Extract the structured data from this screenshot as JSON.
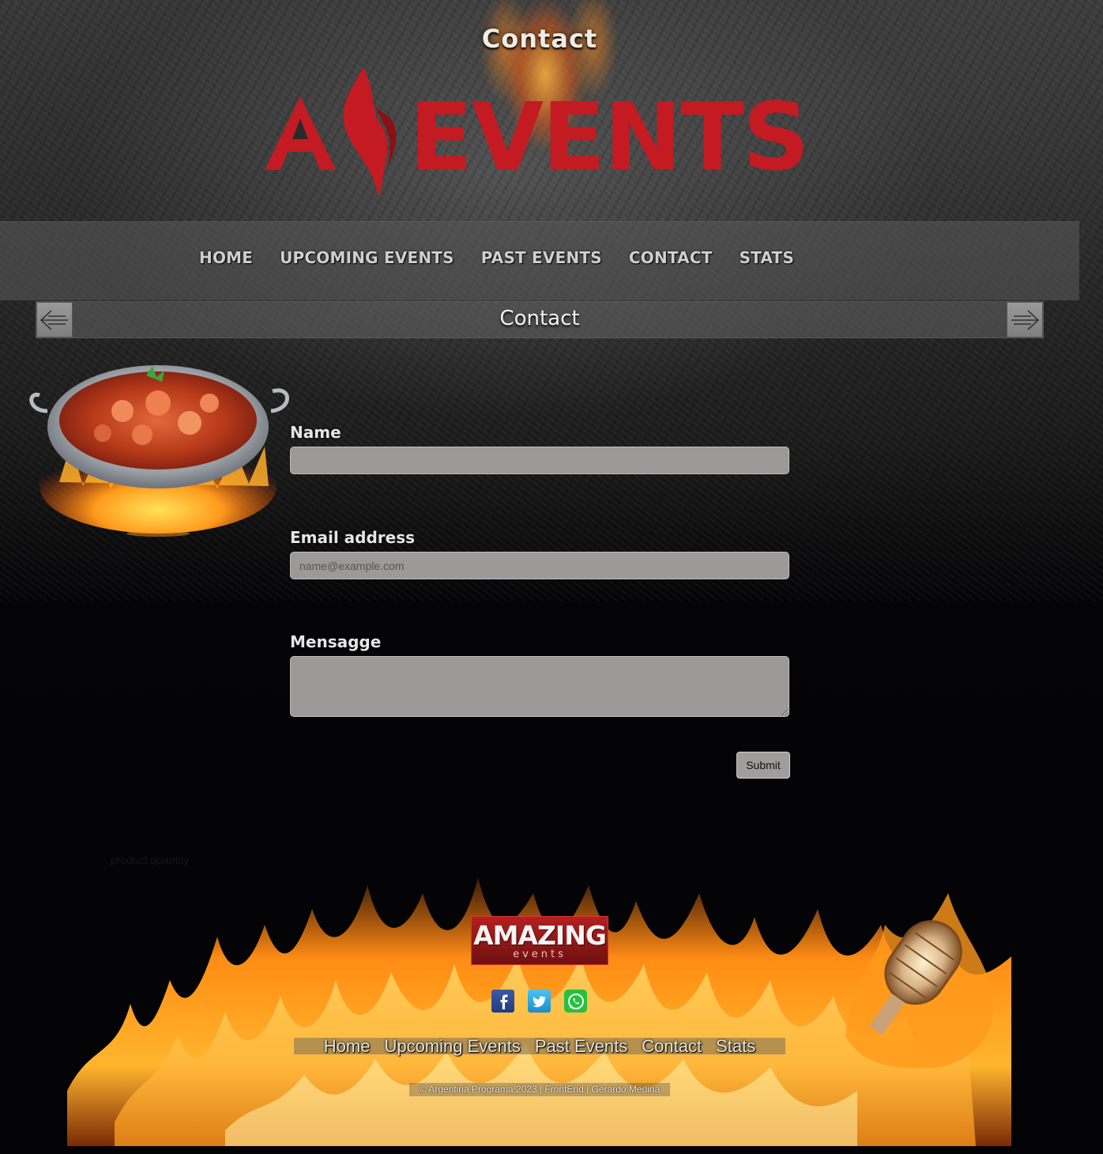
{
  "header": {
    "page_heading": "Contact",
    "logo_text": "EVENTS",
    "logo_icon": "flame-a-logo-icon",
    "brand_color": "#c41a22"
  },
  "nav": {
    "items": [
      {
        "label": "HOME"
      },
      {
        "label": "UPCOMING EVENTS"
      },
      {
        "label": "PAST EVENTS"
      },
      {
        "label": "CONTACT"
      },
      {
        "label": "STATS"
      }
    ]
  },
  "title_bar": {
    "title": "Contact",
    "prev_icon": "arrow-left-icon",
    "next_icon": "arrow-right-icon"
  },
  "form": {
    "name_label": "Name",
    "name_value": "",
    "email_label": "Email address",
    "email_placeholder": "name@example.com",
    "message_label": "Mensagge",
    "message_value": "",
    "submit_label": "Submit"
  },
  "ghost_text": "product quantity",
  "footer": {
    "logo_line1": "AMAZING",
    "logo_line2": "events",
    "social_icons": [
      "facebook-icon",
      "twitter-icon",
      "whatsapp-icon"
    ],
    "links": [
      {
        "label": "Home"
      },
      {
        "label": "Upcoming Events"
      },
      {
        "label": "Past Events"
      },
      {
        "label": "Contact"
      },
      {
        "label": "Stats"
      }
    ],
    "copyright": "© Argentina Programa 2023 | FrontEnd | Gerardo Medina"
  }
}
